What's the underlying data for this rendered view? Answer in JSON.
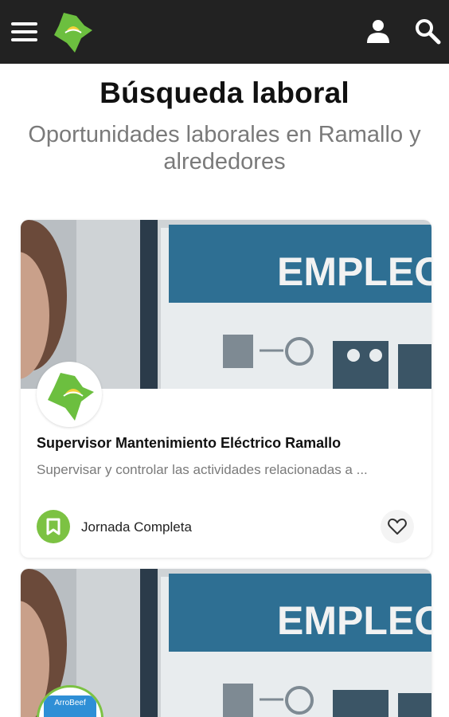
{
  "header": {
    "menu_icon": "hamburger-menu-icon",
    "logo_icon": "municipal-logo-icon",
    "user_icon": "user-icon",
    "search_icon": "search-icon",
    "background": "#222222"
  },
  "page": {
    "title": "Búsqueda laboral",
    "subtitle": "Oportunidades laborales en Ramallo y alrededores"
  },
  "jobs": [
    {
      "image_text": "EMPLEO",
      "title": "Supervisor Mantenimiento Eléctrico Ramallo",
      "description": "Supervisar y controlar las actividades relacionadas a ...",
      "type": "Jornada Completa",
      "type_icon": "bookmark-icon",
      "favorite_icon": "heart-outline-icon"
    },
    {
      "image_text": "EMPLEO",
      "company_logo_text": "ArroBeef"
    }
  ],
  "colors": {
    "accent_green": "#7cc243",
    "poster_blue": "#2e6f93",
    "subtitle_gray": "#7a7a7a"
  }
}
